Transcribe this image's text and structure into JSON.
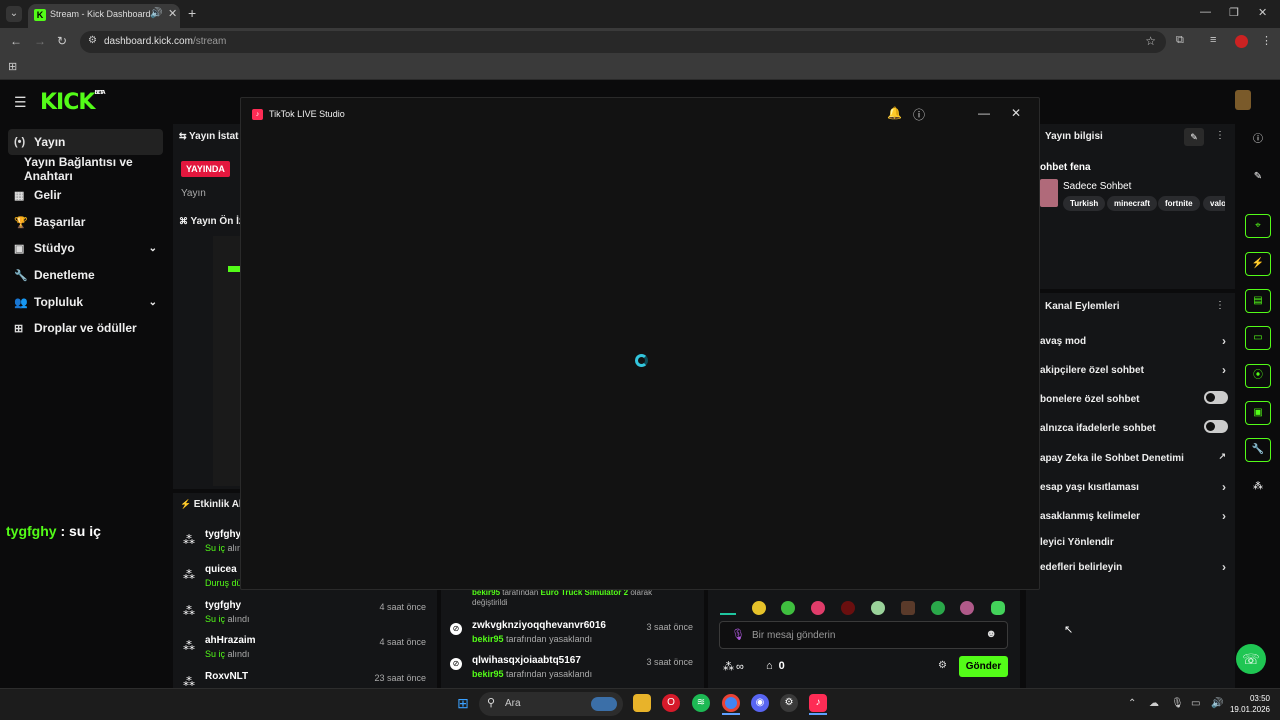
{
  "browser": {
    "tab_title": "Stream - Kick Dashboard",
    "url_host": "dashboard.kick.com",
    "url_path": "/stream"
  },
  "kick": {
    "logo": "KICK",
    "logo_badge": "BETA",
    "sidebar": [
      {
        "icon": "(•)",
        "label": "Yayın"
      },
      {
        "icon": "",
        "label": "Yayın Bağlantısı ve Anahtarı"
      },
      {
        "icon": "▦",
        "label": "Gelir"
      },
      {
        "icon": "🏆",
        "label": "Başarılar"
      },
      {
        "icon": "▣",
        "label": "Stüdyo"
      },
      {
        "icon": "🔧",
        "label": "Denetleme"
      },
      {
        "icon": "👥",
        "label": "Topluluk"
      },
      {
        "icon": "⊞",
        "label": "Droplar ve ödüller"
      }
    ],
    "chat_overlay": {
      "user": "tygfghy",
      "text": " : su iç"
    },
    "stats_panel": {
      "title": "Yayın İstat",
      "live_badge": "YAYINDA",
      "subtitle": "Yayın"
    },
    "preview_panel": {
      "title": "Yayın Ön İz"
    },
    "activity_panel": {
      "title": "Etkinlik Ak",
      "rows": [
        {
          "name": "tygfghy",
          "sub": "Su iç",
          "sub2": " alın",
          "time": ""
        },
        {
          "name": "quicea",
          "sub": "Duruş dü",
          "sub2": "",
          "time": ""
        },
        {
          "name": "tygfghy",
          "sub": "Su iç",
          "sub2": " alındı",
          "time": "4 saat önce"
        },
        {
          "name": "ahHrazaim",
          "sub": "Su iç",
          "sub2": " alındı",
          "time": "4 saat önce"
        },
        {
          "name": "RoxvNLT",
          "sub": "",
          "sub2": "",
          "time": "23 saat önce"
        }
      ]
    },
    "mod_panel": {
      "top_line1_user": "bekir95",
      "top_line1_text": " tarafından ",
      "top_line1_game": "Euro Truck Simulator 2",
      "top_line1_tail": " olarak",
      "top_line2": "değiştirildi",
      "rows": [
        {
          "name": "zwkvgknziyoqqhevanvr6016",
          "by": "bekir95",
          "text": " tarafından yasaklandı",
          "time": "3 saat önce"
        },
        {
          "name": "qlwihasqxjoiaabtq5167",
          "by": "bekir95",
          "text": " tarafından yasaklandı",
          "time": "3 saat önce"
        }
      ]
    },
    "chat": {
      "placeholder": "Bir mesaj gönderin",
      "infinity": "∞",
      "count": "0",
      "send_label": "Gönder"
    },
    "stream_info": {
      "title": "Yayın bilgisi",
      "stream_title": "ohbet fena",
      "category": "Sadece Sohbet",
      "tags": [
        "Turkish",
        "minecraft",
        "fortnite",
        "valo"
      ]
    },
    "channel_actions": {
      "title": "Kanal Eylemleri",
      "items": [
        {
          "label": "avaş mod",
          "control": "chevron"
        },
        {
          "label": "akipçilere özel sohbet",
          "control": "chevron"
        },
        {
          "label": "bonelere özel sohbet",
          "control": "toggle"
        },
        {
          "label": "alnızca ifadelerle sohbet",
          "control": "toggle"
        },
        {
          "label": "apay Zeka ile Sohbet Denetimi",
          "control": "external"
        },
        {
          "label": "esap yaşı kısıtlaması",
          "control": "chevron"
        },
        {
          "label": "asaklanmış kelimeler",
          "control": "chevron"
        },
        {
          "label": "leyici Yönlendir",
          "control": "none"
        },
        {
          "label": "edefleri belirleyin",
          "control": "chevron"
        }
      ]
    }
  },
  "tiktok_modal": {
    "title": "TikTok LIVE Studio"
  },
  "taskbar": {
    "search_placeholder": "Ara",
    "time": "03:50",
    "date": "19.01.2026"
  },
  "colors": {
    "kick_green": "#53fc18",
    "live_red": "#e3173e",
    "tiktok_pink": "#fe2c55",
    "spinner": "#33c6dd"
  }
}
